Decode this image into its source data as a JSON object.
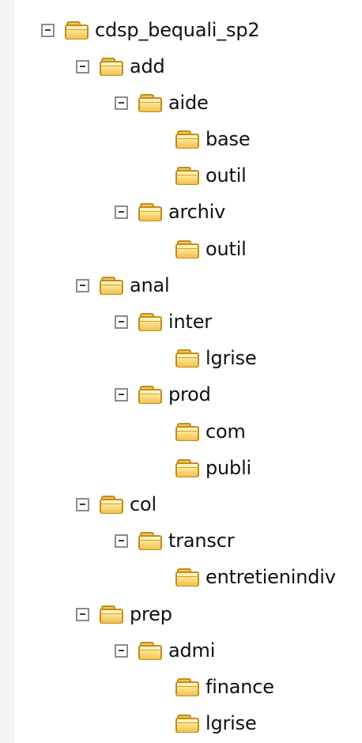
{
  "tree": {
    "root": {
      "label": "cdsp_bequali_sp2",
      "children": {
        "add": {
          "label": "add",
          "aide": {
            "label": "aide",
            "base": "base",
            "outil": "outil"
          },
          "archiv": {
            "label": "archiv",
            "outil": "outil"
          }
        },
        "anal": {
          "label": "anal",
          "inter": {
            "label": "inter",
            "lgrise": "lgrise"
          },
          "prod": {
            "label": "prod",
            "com": "com",
            "publi": "publi"
          }
        },
        "col": {
          "label": "col",
          "transcr": {
            "label": "transcr",
            "entretienindiv": "entretienindiv"
          }
        },
        "prep": {
          "label": "prep",
          "admi": {
            "label": "admi",
            "finance": "finance",
            "lgrise": "lgrise"
          }
        }
      }
    }
  },
  "icons": {
    "expanded_toggle": "minus-box-icon",
    "folder": "folder-icon"
  },
  "colors": {
    "folder_fill": "#f4d77b",
    "folder_border": "#c58c17",
    "toggle_border": "#8c8c8c",
    "text": "#111111",
    "background": "#ffffff"
  }
}
